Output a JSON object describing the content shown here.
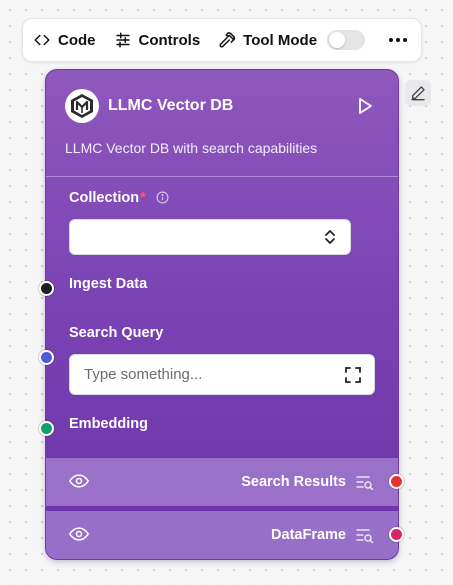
{
  "toolbar": {
    "code_label": "Code",
    "controls_label": "Controls",
    "tool_mode_label": "Tool Mode",
    "tool_mode_enabled": false
  },
  "node": {
    "title": "LLMC Vector DB",
    "description": "LLMC Vector DB with search capabilities",
    "fields": {
      "collection": {
        "label": "Collection",
        "required_mark": "*",
        "value": ""
      },
      "ingest_data": {
        "label": "Ingest Data"
      },
      "search_query": {
        "label": "Search Query",
        "placeholder": "Type something..."
      },
      "embedding": {
        "label": "Embedding"
      }
    },
    "outputs": [
      {
        "label": "Search Results",
        "handle_color": "#e5312f"
      },
      {
        "label": "DataFrame",
        "handle_color": "#d6246e"
      }
    ]
  },
  "handle_colors": {
    "ingest_data": "#1f1f22",
    "search_query": "#4f5bd5",
    "embedding": "#10a06a"
  },
  "icons": {
    "toolbar": [
      "code-icon",
      "sliders-icon",
      "hammer-icon",
      "more-dots-icon"
    ],
    "node": [
      "logo-icon",
      "play-icon",
      "info-icon",
      "chevron-updown-icon",
      "expand-icon",
      "eye-icon",
      "list-search-icon",
      "pencil-icon"
    ]
  }
}
